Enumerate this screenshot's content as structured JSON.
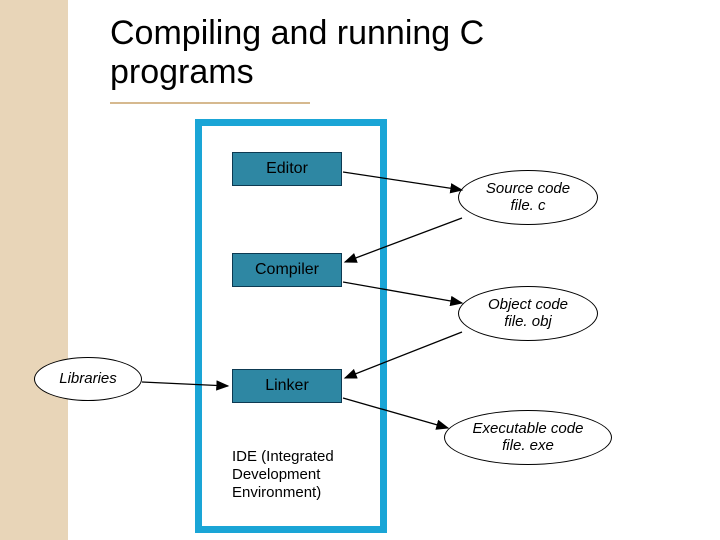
{
  "title": "Compiling and running C programs",
  "nodes": {
    "editor": "Editor",
    "compiler": "Compiler",
    "linker": "Linker"
  },
  "artifacts": {
    "source": {
      "line1": "Source code",
      "line2": "file. c"
    },
    "object": {
      "line1": "Object code",
      "line2": "file. obj"
    },
    "executable": {
      "line1": "Executable code",
      "line2": "file. exe"
    },
    "libraries": "Libraries"
  },
  "caption": "IDE (Integrated\nDevelopment\nEnvironment)"
}
